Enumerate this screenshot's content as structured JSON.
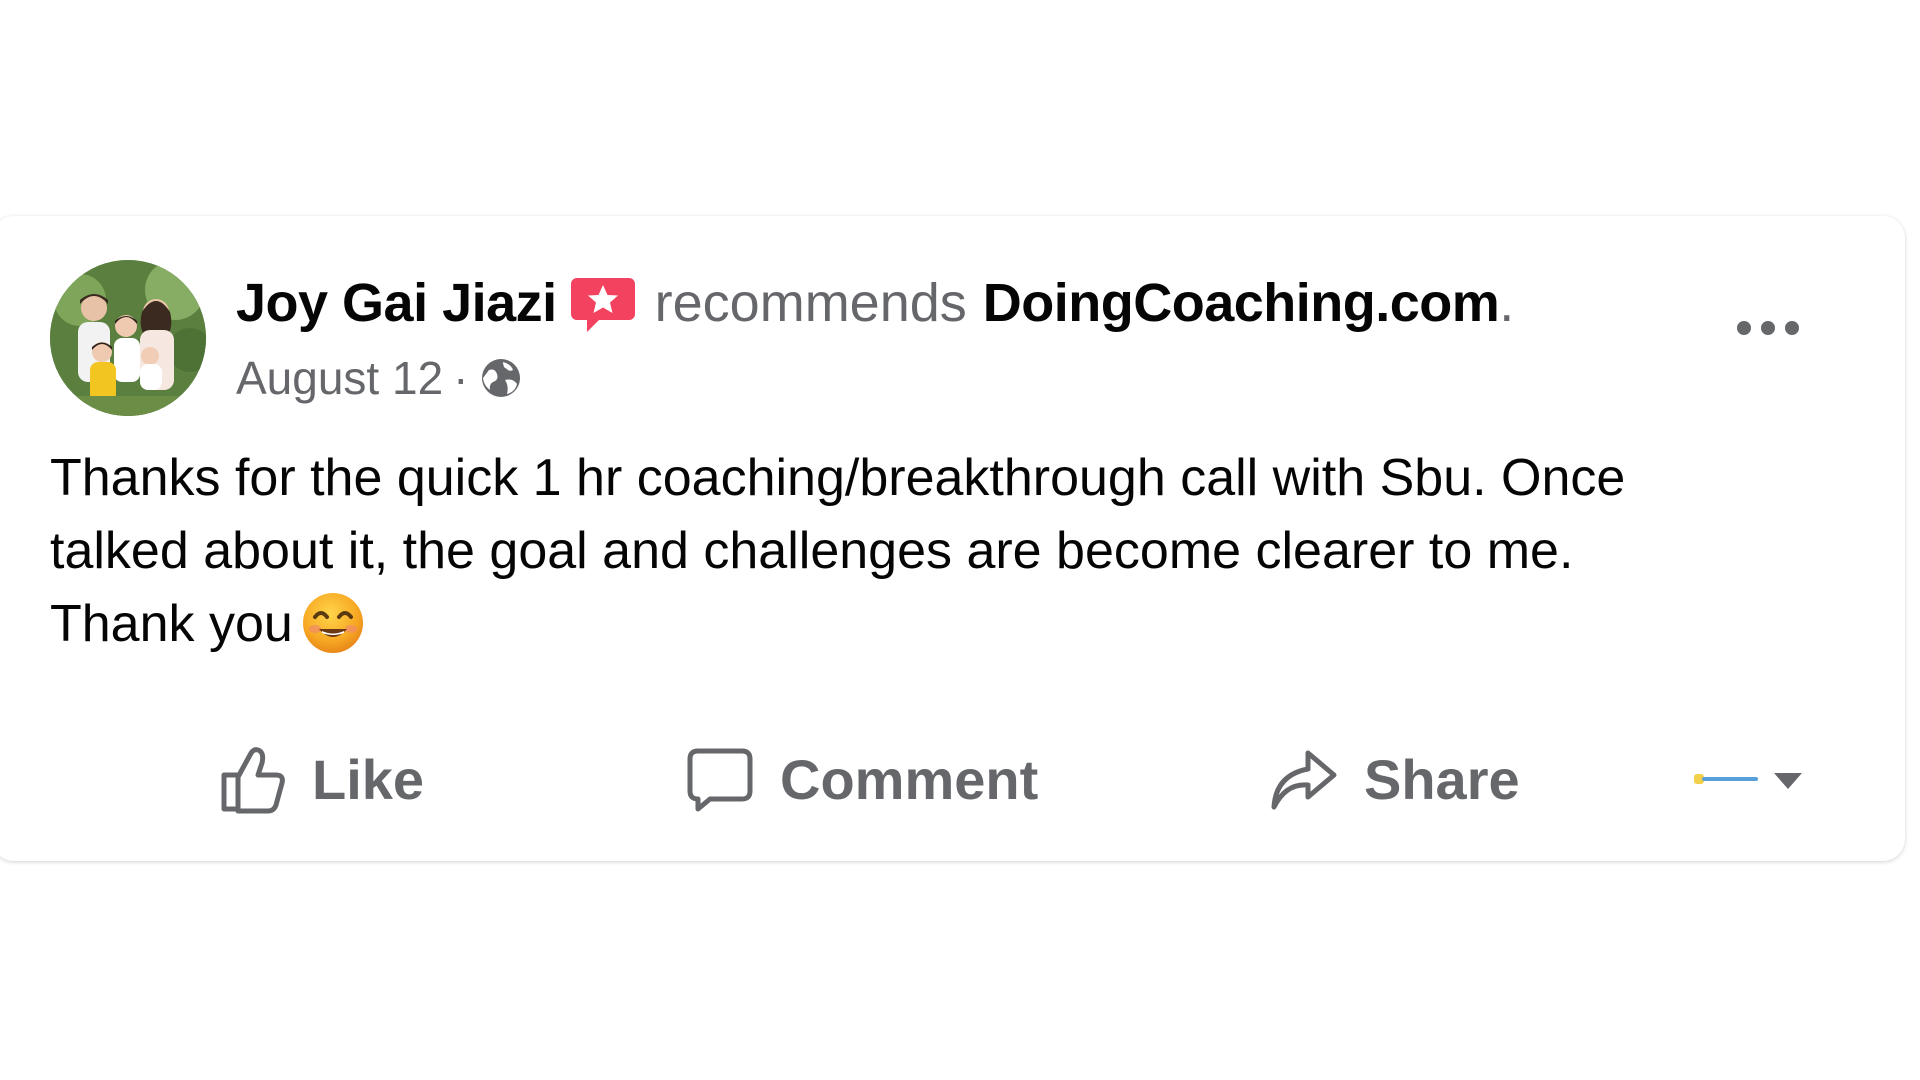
{
  "post": {
    "author": "Joy Gai Jiazi",
    "verb": "recommends",
    "target": "DoingCoaching.com",
    "target_suffix": ".",
    "date": "August 12",
    "date_separator": "·",
    "privacy_icon": "globe-icon",
    "body_text": "Thanks for the quick 1 hr coaching/breakthrough call with Sbu. Once\ntalked about it, the goal and challenges are become clearer to me.\nThank you",
    "body_emoji": "smiling-face-emoji"
  },
  "actions": {
    "like_label": "Like",
    "comment_label": "Comment",
    "share_label": "Share"
  },
  "colors": {
    "primary_text": "#050505",
    "secondary_text": "#65676b",
    "recommend_badge": "#f3425f",
    "background": "#ffffff"
  }
}
